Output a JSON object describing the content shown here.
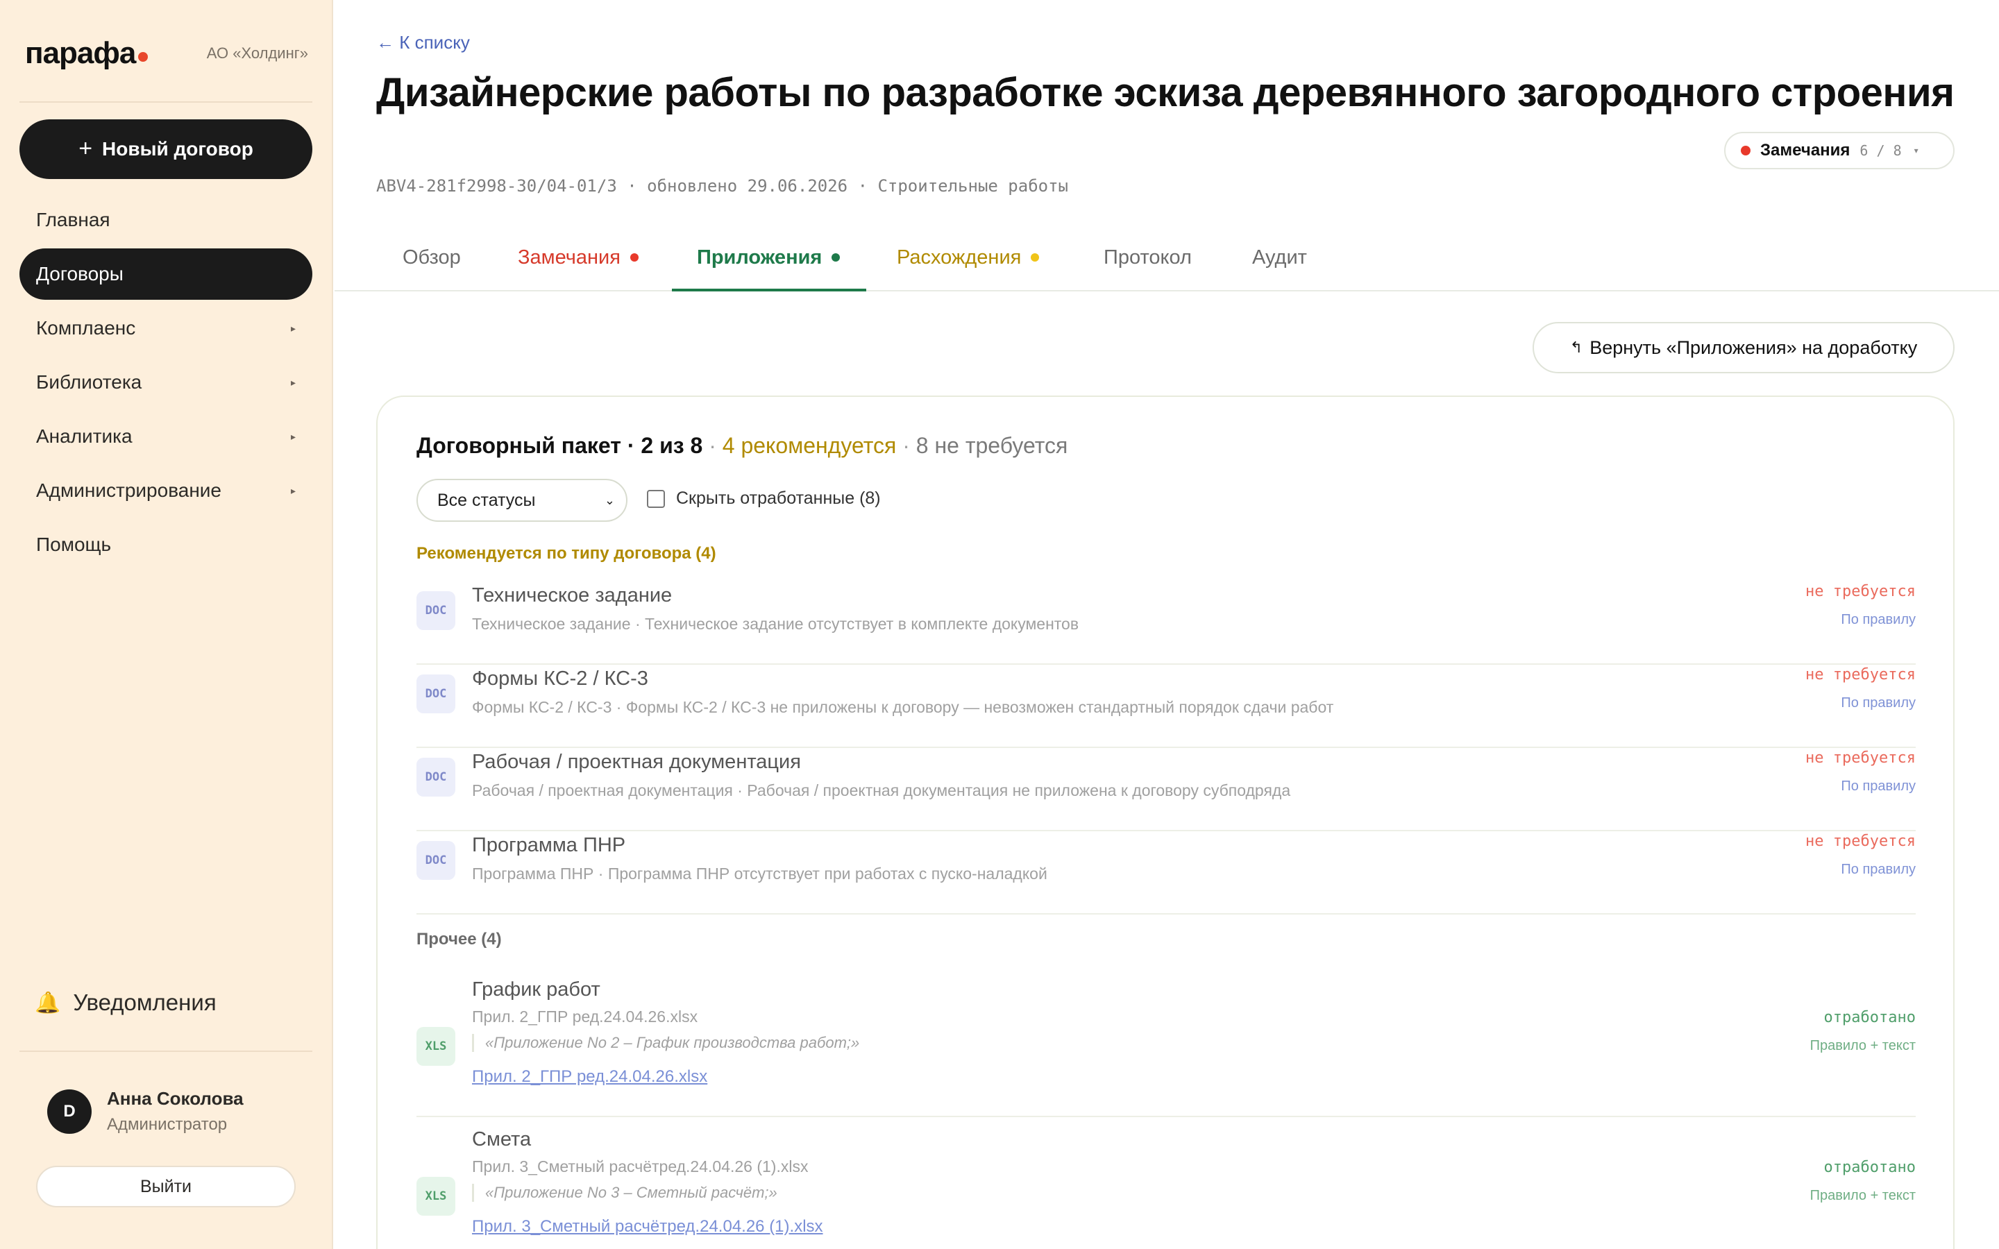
{
  "app": {
    "logo": "парафа",
    "org": "АО «Холдинг»",
    "new_contract_label": "Новый договор",
    "nav": [
      {
        "label": "Главная",
        "arrow": false,
        "active": false
      },
      {
        "label": "Договоры",
        "arrow": false,
        "active": true
      },
      {
        "label": "Комплаенс",
        "arrow": true,
        "active": false
      },
      {
        "label": "Библиотека",
        "arrow": true,
        "active": false
      },
      {
        "label": "Аналитика",
        "arrow": true,
        "active": false
      },
      {
        "label": "Администрирование",
        "arrow": true,
        "active": false
      },
      {
        "label": "Помощь",
        "arrow": false,
        "active": false
      }
    ],
    "notifications_label": "Уведомления",
    "user": {
      "initial": "D",
      "name": "Анна Соколова",
      "role": "Администратор"
    },
    "logout_label": "Выйти"
  },
  "header": {
    "back_label": "← К списку",
    "title": "Дизайнерские работы по разработке эскиза деревянного загородного строения",
    "meta": "ABV4-281f2998-30/04-01/3 · обновлено 29.06.2026 · Строительные работы",
    "remarks": {
      "label": "Замечания",
      "count": "6 / 8"
    }
  },
  "tabs": [
    {
      "label": "Обзор",
      "dot": null,
      "color": "#6b6b6b"
    },
    {
      "label": "Замечания",
      "dot": "#e8392b",
      "color": "#d63a2b"
    },
    {
      "label": "Приложения",
      "dot": "#1e7a4a",
      "color": "#1e7a4a",
      "active": true
    },
    {
      "label": "Расхождения",
      "dot": "#f0c419",
      "color": "#b08a00"
    },
    {
      "label": "Протокол",
      "dot": null,
      "color": "#6b6b6b"
    },
    {
      "label": "Аудит",
      "dot": null,
      "color": "#6b6b6b"
    }
  ],
  "return_button_label": "Вернуть «Приложения» на доработку",
  "package": {
    "title": "Договорный пакет · 2 из 8",
    "recommended": "4 рекомендуется",
    "not_required": "8 не требуется",
    "status_filter": "Все статусы",
    "hide_worked_label": "Скрыть отработанные (8)",
    "recommended_section": "Рекомендуется по типу договора (4)",
    "other_section": "Прочее (4)",
    "recommended_items": [
      {
        "type": "DOC",
        "title": "Техническое задание",
        "subtitle": "Техническое задание · Техническое задание отсутствует в комплекте документов",
        "status": "не требуется",
        "rule": "По правилу"
      },
      {
        "type": "DOC",
        "title": "Формы КС-2 / КС-3",
        "subtitle": "Формы КС-2 / КС-3 · Формы КС-2 / КС-3 не приложены к договору — невозможен стандартный порядок сдачи работ",
        "status": "не требуется",
        "rule": "По правилу"
      },
      {
        "type": "DOC",
        "title": "Рабочая / проектная документация",
        "subtitle": "Рабочая / проектная документация · Рабочая / проектная документация не приложена к договору субподряда",
        "status": "не требуется",
        "rule": "По правилу"
      },
      {
        "type": "DOC",
        "title": "Программа ПНР",
        "subtitle": "Программа ПНР · Программа ПНР отсутствует при работах с пуско-наладкой",
        "status": "не требуется",
        "rule": "По правилу"
      }
    ],
    "other_items": [
      {
        "type": "XLS",
        "title": "График работ",
        "file": "Прил. 2_ГПР ред.24.04.26.xlsx",
        "quote": "«Приложение No 2 – График производства работ;»",
        "link": "Прил. 2_ГПР ред.24.04.26.xlsx",
        "status": "отработано",
        "rule": "Правило + текст"
      },
      {
        "type": "XLS",
        "title": "Смета",
        "file": "Прил. 3_Сметный расчётред.24.04.26 (1).xlsx",
        "quote": "«Приложение No 3 – Сметный расчёт;»",
        "link": "Прил. 3_Сметный расчётред.24.04.26 (1).xlsx",
        "status": "отработано",
        "rule": "Правило + текст"
      }
    ]
  }
}
